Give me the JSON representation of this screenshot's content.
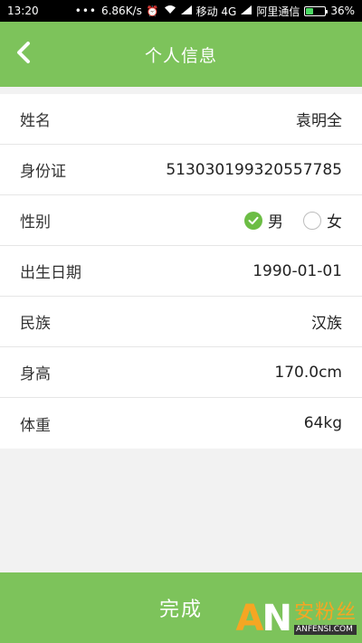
{
  "status_bar": {
    "time": "13:20",
    "dots": "•••",
    "speed": "6.86K/s",
    "carrier1": "移动 4G",
    "carrier2": "阿里通信",
    "battery": "36%"
  },
  "header": {
    "title": "个人信息",
    "back_icon": "chevron-left-icon"
  },
  "form": {
    "rows": [
      {
        "label": "姓名",
        "value": "袁明全"
      },
      {
        "label": "身份证",
        "value": "513030199320557785"
      },
      {
        "label": "性别",
        "male": "男",
        "female": "女",
        "selected": "男"
      },
      {
        "label": "出生日期",
        "value": "1990-01-01"
      },
      {
        "label": "民族",
        "value": "汉族"
      },
      {
        "label": "身高",
        "value": "170.0cm"
      },
      {
        "label": "体重",
        "value": "64kg"
      }
    ]
  },
  "footer": {
    "finish_label": "完成"
  },
  "watermark": {
    "letters": "AN",
    "cn": "安粉丝",
    "en": "ANFENSI.COM"
  },
  "colors": {
    "primary_green": "#7dc35b",
    "check_green": "#6cbd45"
  }
}
